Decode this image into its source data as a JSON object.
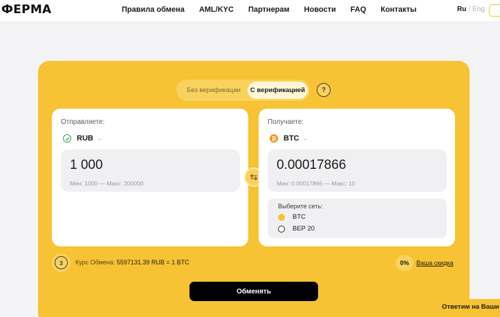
{
  "header": {
    "logo": "ФЕРМА",
    "nav": [
      "Правила обмена",
      "AML/KYC",
      "Партнерам",
      "Новости",
      "FAQ",
      "Контакты"
    ],
    "lang_ru": "Ru",
    "lang_sep": "/",
    "lang_en": "Eng"
  },
  "verification": {
    "without": "Без верификации",
    "with": "С верификацией",
    "help": "?"
  },
  "send": {
    "label": "Отправляете:",
    "currency": "RUB",
    "amount": "1 000",
    "limits": "Мин: 1000 — Макс: 200000"
  },
  "receive": {
    "label": "Получаете:",
    "currency": "BTC",
    "amount": "0.00017866",
    "limits": "Мин: 0.00017866 — Макс: 10",
    "network_title": "Выберите сеть:",
    "networks": [
      {
        "label": "BTC",
        "selected": true
      },
      {
        "label": "BEP 20",
        "selected": false
      }
    ]
  },
  "rate": {
    "countdown": "3",
    "label": "Курс Обмена:",
    "value": "5597131.39 RUB = 1 BTC"
  },
  "discount": {
    "percent": "0%",
    "link": "Ваша скидка"
  },
  "exchange_button": "Обменять",
  "chat_widget": "Ответим на Ваши вопросы",
  "colors": {
    "accent": "#f7c233",
    "button": "#000000",
    "rub_icon": "#2ea44f",
    "btc_icon": "#f7931a"
  },
  "icons": {
    "rub": "check-circle-icon",
    "btc": "bitcoin-icon",
    "swap": "swap-arrows-icon",
    "help": "question-circle-icon"
  }
}
